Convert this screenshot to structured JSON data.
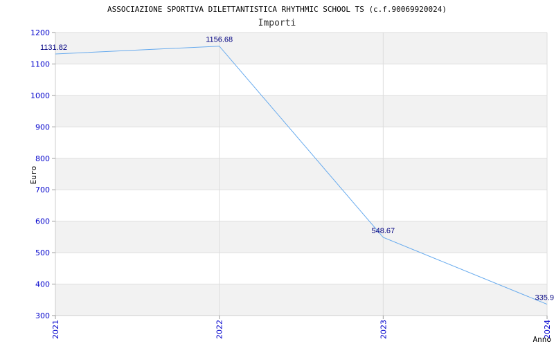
{
  "chart_data": {
    "type": "line",
    "title": "ASSOCIAZIONE SPORTIVA DILETTANTISTICA RHYTHMIC SCHOOL TS (c.f.90069920024)",
    "subtitle": "Importi",
    "xlabel": "Anno",
    "ylabel": "Euro",
    "categories": [
      "2021",
      "2022",
      "2023",
      "2024"
    ],
    "series": [
      {
        "values": [
          1131.82,
          1156.68,
          548.67,
          335.9
        ],
        "labels": [
          "1131.82",
          "1156.68",
          "548.67",
          "335.9"
        ],
        "color": "#66aaee"
      }
    ],
    "ylim": [
      300,
      1200
    ],
    "yticks": [
      "300",
      "400",
      "500",
      "600",
      "700",
      "800",
      "900",
      "1000",
      "1100",
      "1200"
    ],
    "grid": true,
    "band_colors": [
      "#ffffff",
      "#f2f2f2"
    ]
  }
}
